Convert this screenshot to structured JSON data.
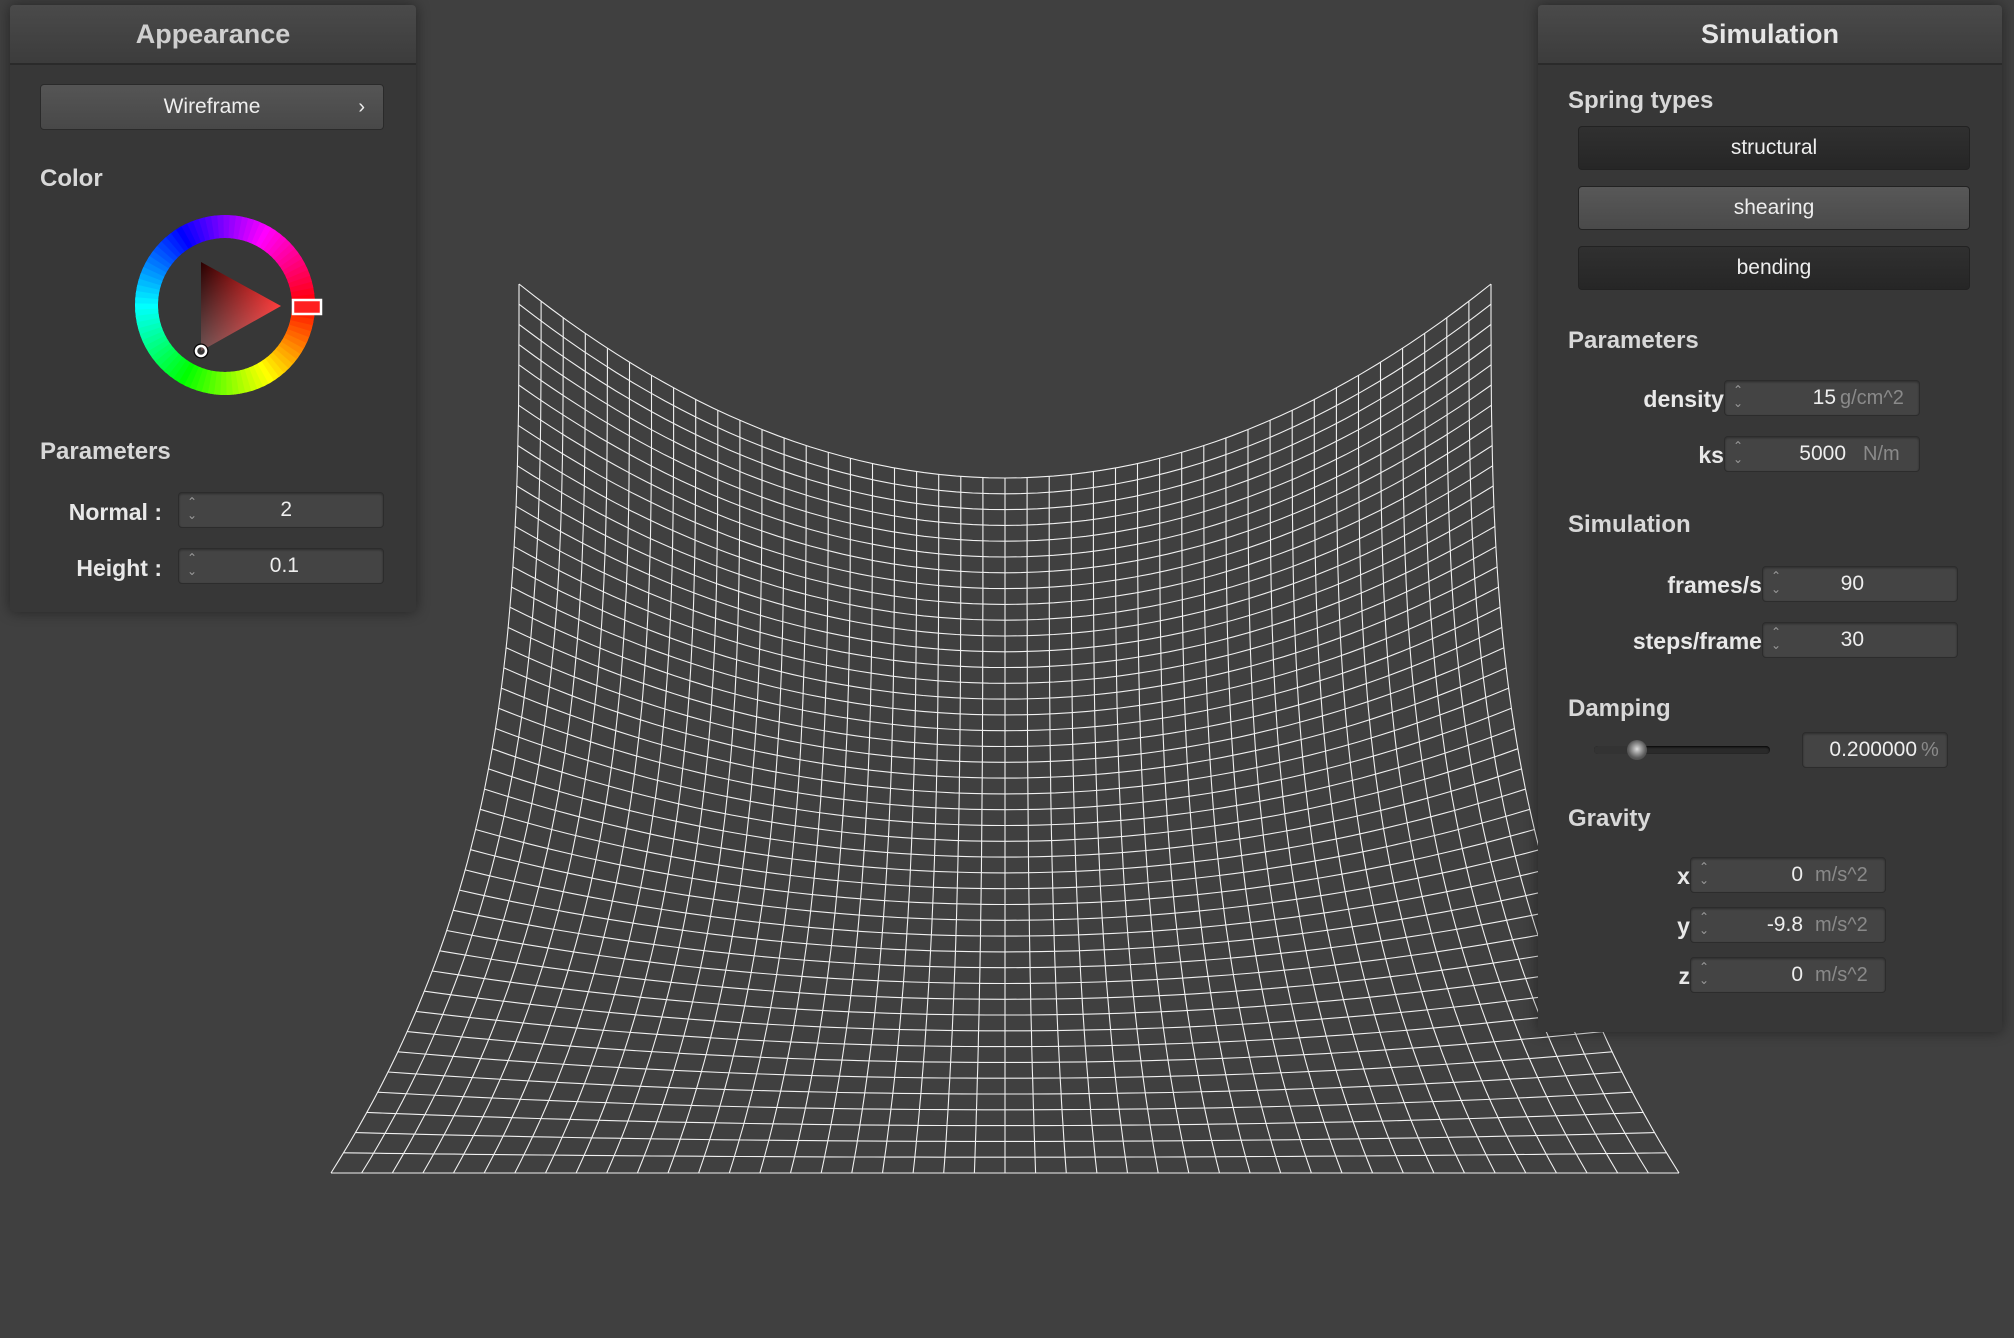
{
  "appearance": {
    "title": "Appearance",
    "shading_mode": "Wireframe",
    "color_label": "Color",
    "params_label": "Parameters",
    "normal": {
      "label": "Normal :",
      "value": "2"
    },
    "height": {
      "label": "Height :",
      "value": "0.1"
    },
    "color_picker": {
      "hue": "#ff1a1a",
      "selected": "#ff2020"
    }
  },
  "simulation": {
    "title": "Simulation",
    "spring_types_label": "Spring types",
    "spring_types": [
      {
        "label": "structural",
        "active": true
      },
      {
        "label": "shearing",
        "active": false
      },
      {
        "label": "bending",
        "active": true
      }
    ],
    "params_label": "Parameters",
    "density": {
      "label": "density :",
      "value": "15",
      "unit": "g/cm^2"
    },
    "ks": {
      "label": "ks :",
      "value": "5000",
      "unit": "N/m"
    },
    "sim_label": "Simulation",
    "fps": {
      "label": "frames/s :",
      "value": "90"
    },
    "steps": {
      "label": "steps/frame :",
      "value": "30"
    },
    "damping_label": "Damping",
    "damping": {
      "value": "0.200000",
      "unit": "%",
      "slider_fraction": 0.2
    },
    "gravity_label": "Gravity",
    "gravity": [
      {
        "label": "x :",
        "value": "0",
        "unit": "m/s^2"
      },
      {
        "label": "y :",
        "value": "-9.8",
        "unit": "m/s^2"
      },
      {
        "label": "z :",
        "value": "0",
        "unit": "m/s^2"
      }
    ]
  },
  "cloth": {
    "mode": "wireframe",
    "grid_columns": 44,
    "grid_rows": 44,
    "line_color": "#ffffff"
  },
  "colors": {
    "background": "#404040",
    "panel": "#373737"
  }
}
